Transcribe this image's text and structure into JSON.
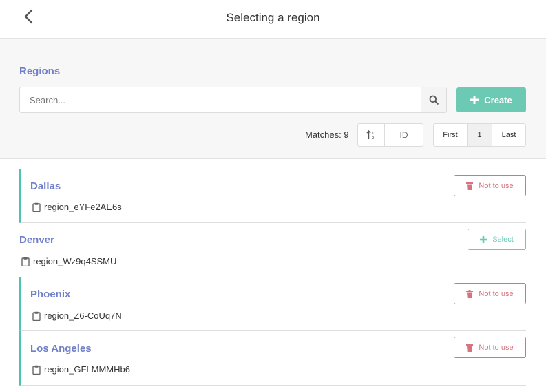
{
  "header": {
    "title": "Selecting a region"
  },
  "section": {
    "title": "Regions"
  },
  "search": {
    "placeholder": "Search...",
    "value": ""
  },
  "toolbar": {
    "create_label": "Create",
    "matches_text": "Matches: 9",
    "sort_field": "ID"
  },
  "pagination": {
    "first": "First",
    "current": "1",
    "last": "Last"
  },
  "regions": [
    {
      "name": "Dallas",
      "id": "region_eYFe2AE6s",
      "action": "Not to use"
    },
    {
      "name": "Denver",
      "id": "region_Wz9q4SSMU",
      "action": "Select"
    },
    {
      "name": "Phoenix",
      "id": "region_Z6-CoUq7N",
      "action": "Not to use"
    },
    {
      "name": "Los Angeles",
      "id": "region_GFLMMMHb6",
      "action": "Not to use"
    }
  ],
  "colors": {
    "accent": "#6f7fc8",
    "success": "#6cc9b4",
    "danger": "#d9727f",
    "active_border": "#4dc3b2"
  }
}
